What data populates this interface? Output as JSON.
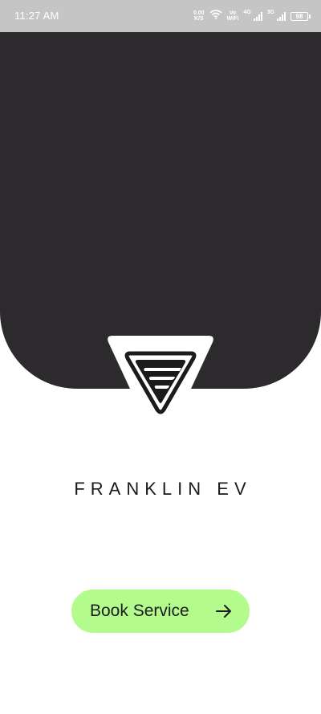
{
  "status_bar": {
    "time": "11:27 AM",
    "net_speed_value": "0.00",
    "net_speed_unit": "K/S",
    "vo_label_top": "Vo",
    "vo_label_bottom": "WiFi",
    "network_1": "4G",
    "network_2": "3G",
    "battery_level": "98"
  },
  "brand": {
    "name": "FRANKLIN EV"
  },
  "actions": {
    "book_service_label": "Book Service"
  },
  "icons": {
    "logo": "franklin-ev-triangle-logo",
    "arrow": "arrow-right-icon"
  },
  "colors": {
    "hero_background": "#2c2a2c",
    "button_background": "#b3fb8c",
    "status_bar_background": "#c6c5c6",
    "text_dark": "#1a1a1a"
  }
}
